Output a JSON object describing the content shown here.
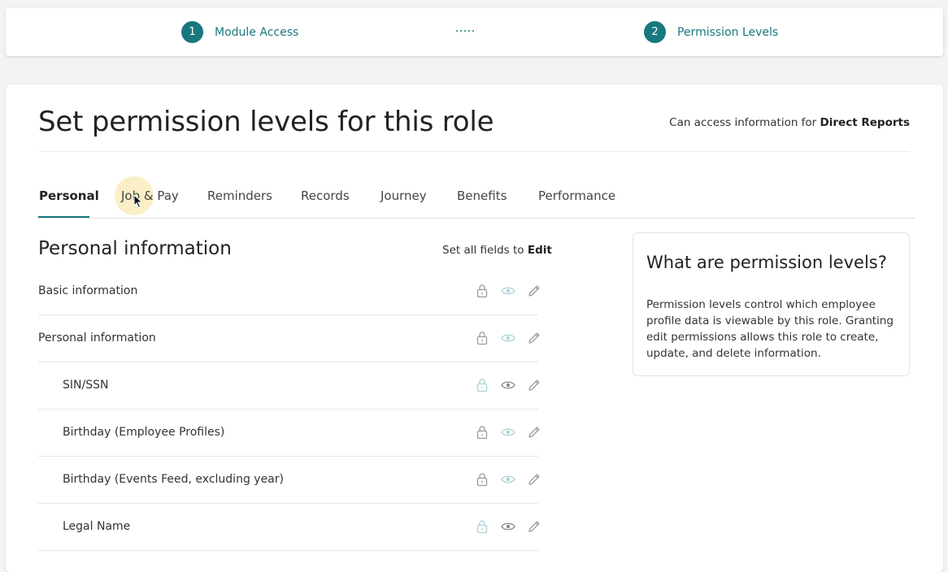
{
  "stepper": {
    "steps": [
      {
        "number": "1",
        "label": "Module Access"
      },
      {
        "number": "2",
        "label": "Permission Levels"
      }
    ]
  },
  "header": {
    "title": "Set permission levels for this role",
    "access_prefix": "Can access information for",
    "access_target": "Direct Reports"
  },
  "tabs": [
    {
      "label": "Personal",
      "active": true
    },
    {
      "label": "Job & Pay",
      "active": false
    },
    {
      "label": "Reminders",
      "active": false
    },
    {
      "label": "Records",
      "active": false
    },
    {
      "label": "Journey",
      "active": false
    },
    {
      "label": "Benefits",
      "active": false
    },
    {
      "label": "Performance",
      "active": false
    }
  ],
  "section": {
    "title": "Personal information",
    "set_all_prefix": "Set all fields to",
    "set_all_value": "Edit"
  },
  "rows": [
    {
      "label": "Basic information",
      "indent": false,
      "selected": "none"
    },
    {
      "label": "Personal information",
      "indent": false,
      "selected": "none"
    },
    {
      "label": "SIN/SSN",
      "indent": true,
      "selected": "view"
    },
    {
      "label": "Birthday (Employee Profiles)",
      "indent": true,
      "selected": "none"
    },
    {
      "label": "Birthday (Events Feed, excluding year)",
      "indent": true,
      "selected": "none"
    },
    {
      "label": "Legal Name",
      "indent": true,
      "selected": "view"
    }
  ],
  "info": {
    "title": "What are permission levels?",
    "body": "Permission levels control which employee profile data is viewable by this role. Granting edit permissions allows this role to create, update, and delete information."
  },
  "colors": {
    "accent": "#18777f",
    "icon_gray": "#9a9a9a",
    "icon_light_teal": "#a9d3d6"
  }
}
